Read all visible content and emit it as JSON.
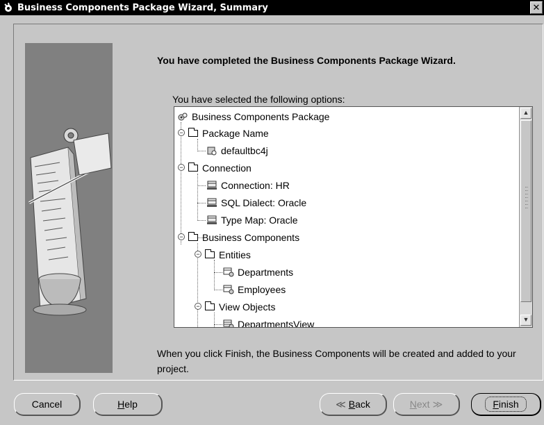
{
  "window": {
    "title": "Business Components Package Wizard, Summary",
    "close_glyph": "✕"
  },
  "main": {
    "heading": "You have completed the Business Components Package Wizard.",
    "options_label": "You have selected the following options:",
    "footer_text": "When you click Finish, the Business Components will be created and added to your project."
  },
  "tree": {
    "items": [
      {
        "label": "Business Components Package",
        "icon": "components-gear-icon"
      },
      {
        "label": "Package Name",
        "icon": "folder-icon"
      },
      {
        "label": "defaultbc4j",
        "icon": "package-icon"
      },
      {
        "label": "Connection",
        "icon": "folder-icon"
      },
      {
        "label": "Connection: HR",
        "icon": "connection-icon"
      },
      {
        "label": "SQL Dialect: Oracle",
        "icon": "connection-icon"
      },
      {
        "label": "Type Map: Oracle",
        "icon": "connection-icon"
      },
      {
        "label": "Business Components",
        "icon": "folder-icon"
      },
      {
        "label": "Entities",
        "icon": "folder-icon"
      },
      {
        "label": "Departments",
        "icon": "entity-icon"
      },
      {
        "label": "Employees",
        "icon": "entity-icon"
      },
      {
        "label": "View Objects",
        "icon": "folder-icon"
      },
      {
        "label": "DepartmentsView",
        "icon": "view-object-icon"
      }
    ],
    "scroll_up_glyph": "▲",
    "scroll_down_glyph": "▼"
  },
  "buttons": {
    "cancel": "Cancel",
    "help_mnemonic": "H",
    "help_rest": "elp",
    "back_glyph": "≪",
    "back_mnemonic": "B",
    "back_rest": "ack",
    "next_mnemonic": "N",
    "next_rest": "ext",
    "next_glyph": "≫",
    "finish_mnemonic": "F",
    "finish_rest": "inish"
  }
}
